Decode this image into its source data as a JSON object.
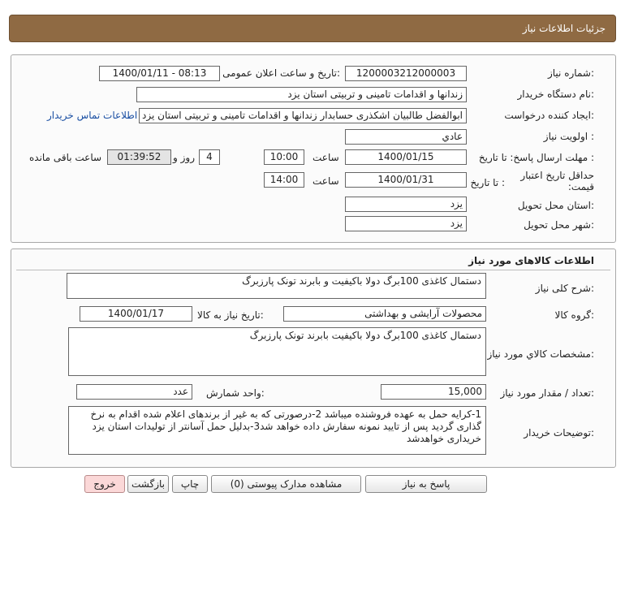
{
  "header": {
    "title": "جزئیات اطلاعات نیاز"
  },
  "need": {
    "number_label": "شماره نیاز:",
    "number": "1200003212000003",
    "announce_label": "تاریخ و ساعت اعلان عمومی:",
    "announce": "1400/01/11 - 08:13",
    "buyer_label": "نام دستگاه خریدار:",
    "buyer": "زندانها و اقدامات تامینی و تربیتی استان یزد",
    "creator_label": "ایجاد کننده درخواست:",
    "creator": "ابوالفضل  طالبیان اشکذری حسابدار زندانها و اقدامات تامینی و تربیتی استان یزد",
    "contact_link": "اطلاعات تماس خریدار",
    "priority_label": "اولویت نیاز :",
    "priority": "عادي",
    "deadline_label": "مهلت ارسال پاسخ:  تا تاریخ :",
    "deadline_date": "1400/01/15",
    "time_label": "ساعت",
    "deadline_time": "10:00",
    "days": "4",
    "days_suffix": "روز و",
    "remaining": "01:39:52",
    "remaining_label": "ساعت باقی مانده",
    "validity_label": "حداقل تاریخ اعتبار قیمت:",
    "validity_to_label": "تا تاریخ :",
    "validity_date": "1400/01/31",
    "validity_time": "14:00",
    "province_label": "استان محل تحویل:",
    "province": "یزد",
    "city_label": "شهر محل تحویل:",
    "city": "یزد"
  },
  "goods": {
    "section_title": "اطلاعات کالاهای مورد نیاز",
    "summary_label": "شرح کلی نیاز:",
    "summary": "دستمال کاغذی 100برگ دولا باکیفیت و بابرند تونک پارزبرگ",
    "group_label": "گروه کالا:",
    "group": "محصولات آرایشی و بهداشتی",
    "need_date_label": "تاریخ نیاز به کالا:",
    "need_date": "1400/01/17",
    "spec_label": "مشخصات کالاي مورد نیاز:",
    "spec": "دستمال کاغذی 100برگ دولا باکیفیت بابرند تونک پارزبرگ",
    "qty_label": "تعداد / مقدار مورد نیاز:",
    "qty": "15,000",
    "unit_label": "واحد شمارش:",
    "unit": "عدد",
    "notes_label": "توضیحات خریدار:",
    "notes": "1-کرایه حمل به عهده فروشنده میباشد 2-درصورتی که به غیر از برندهای اعلام شده اقدام به نرخ گذاری گردید پس از تایید نمونه سفارش داده خواهد شد3-بدلیل حمل آسانتر از تولیدات استان یزد خریداری خواهدشد"
  },
  "buttons": {
    "reply": "پاسخ به نیاز",
    "attachments": "مشاهده مدارک پیوستی (0)",
    "print": "چاپ",
    "back": "بازگشت",
    "exit": "خروج"
  }
}
